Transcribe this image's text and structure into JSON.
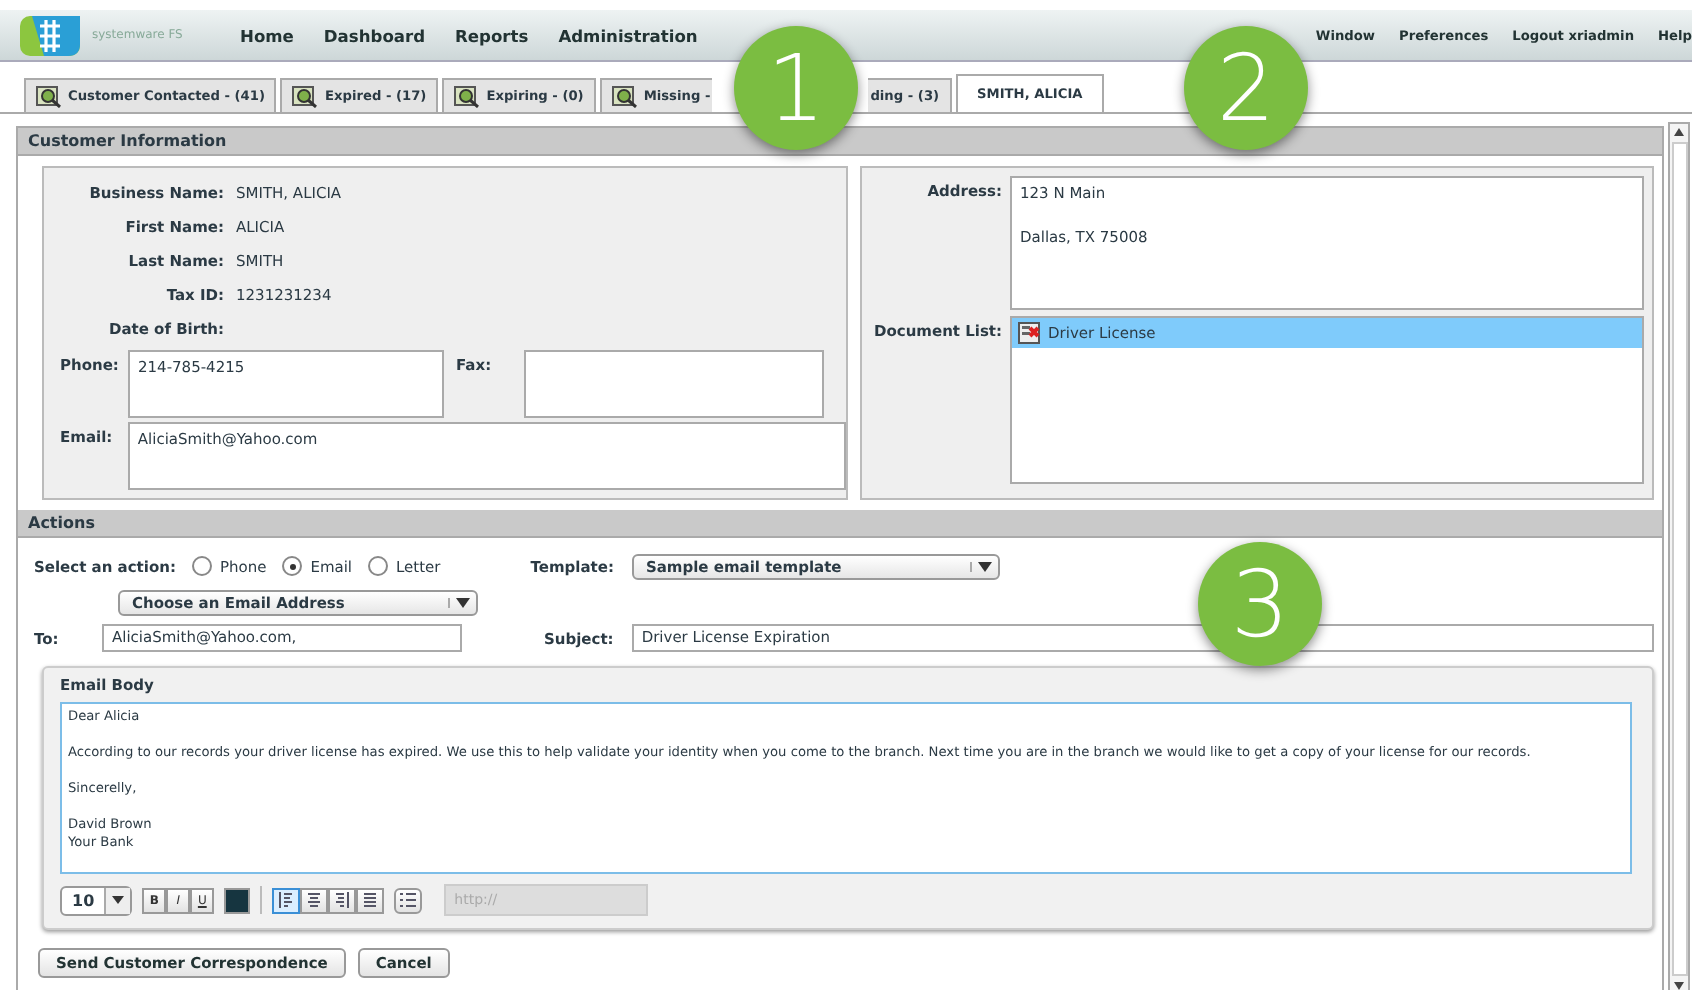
{
  "nav": {
    "logo_text": "systemware FS",
    "menu": [
      "Home",
      "Dashboard",
      "Reports",
      "Administration"
    ],
    "right_menu": [
      "Window",
      "Preferences",
      "Logout xriadmin",
      "Help"
    ]
  },
  "tabs": [
    {
      "label": "Customer Contacted - (41)",
      "icon": true,
      "selected": false
    },
    {
      "label": "Expired - (17)",
      "icon": true,
      "selected": false
    },
    {
      "label": "Expiring - (0)",
      "icon": true,
      "selected": false
    },
    {
      "label": "Missing -",
      "icon": true,
      "selected": false
    },
    {
      "label": "ding - (3)",
      "icon": false,
      "selected": false
    },
    {
      "label": "SMITH, ALICIA",
      "icon": false,
      "selected": true
    }
  ],
  "callouts": [
    "1",
    "2",
    "3"
  ],
  "customer": {
    "title": "Customer Information",
    "fields": [
      {
        "label": "Business Name:",
        "value": "SMITH, ALICIA"
      },
      {
        "label": "First Name:",
        "value": "ALICIA"
      },
      {
        "label": "Last Name:",
        "value": "SMITH"
      },
      {
        "label": "Tax ID:",
        "value": "1231231234"
      },
      {
        "label": "Date of Birth:"
      }
    ],
    "phone": {
      "label": "Phone:",
      "value": "214-785-4215"
    },
    "fax": {
      "label": "Fax:"
    },
    "email": {
      "label": "Email:",
      "value": "AliciaSmith@Yahoo.com"
    },
    "address": {
      "label": "Address:",
      "lines": [
        "123 N Main",
        "Dallas, TX 75008"
      ]
    },
    "documents": {
      "label": "Document List:",
      "items": [
        {
          "name": "Driver License",
          "selected": true
        }
      ]
    }
  },
  "actions": {
    "title": "Actions",
    "action_label": "Select an action:",
    "options": [
      {
        "label": "Phone",
        "selected": false
      },
      {
        "label": "Email",
        "selected": true
      },
      {
        "label": "Letter",
        "selected": false
      }
    ],
    "template": {
      "label": "Template:",
      "value": "Sample email template"
    },
    "address_chooser": "Choose an Email Address",
    "to": {
      "label": "To:",
      "value": "AliciaSmith@Yahoo.com,"
    },
    "subject": {
      "label": "Subject:",
      "value": "Driver License Expiration"
    },
    "body": {
      "title": "Email Body",
      "paragraphs": [
        [
          "Dear Alicia"
        ],
        [
          "According to our records your driver license has expired.  We use this to help validate your identity when you come to the branch.  Next time you are in the branch we would like to get a copy of your license for our records."
        ],
        [
          "Sincerelly,"
        ],
        [
          "David Brown",
          "Your Bank"
        ]
      ]
    },
    "toolbar": {
      "font_size": "10",
      "styles": [
        "B",
        "I",
        "U"
      ],
      "align": [
        {
          "selected": true
        },
        {
          "selected": false
        },
        {
          "selected": false
        },
        {
          "selected": false
        }
      ],
      "link_placeholder": "http://"
    }
  },
  "buttons": [
    "Send Customer Correspondence",
    "Cancel"
  ]
}
